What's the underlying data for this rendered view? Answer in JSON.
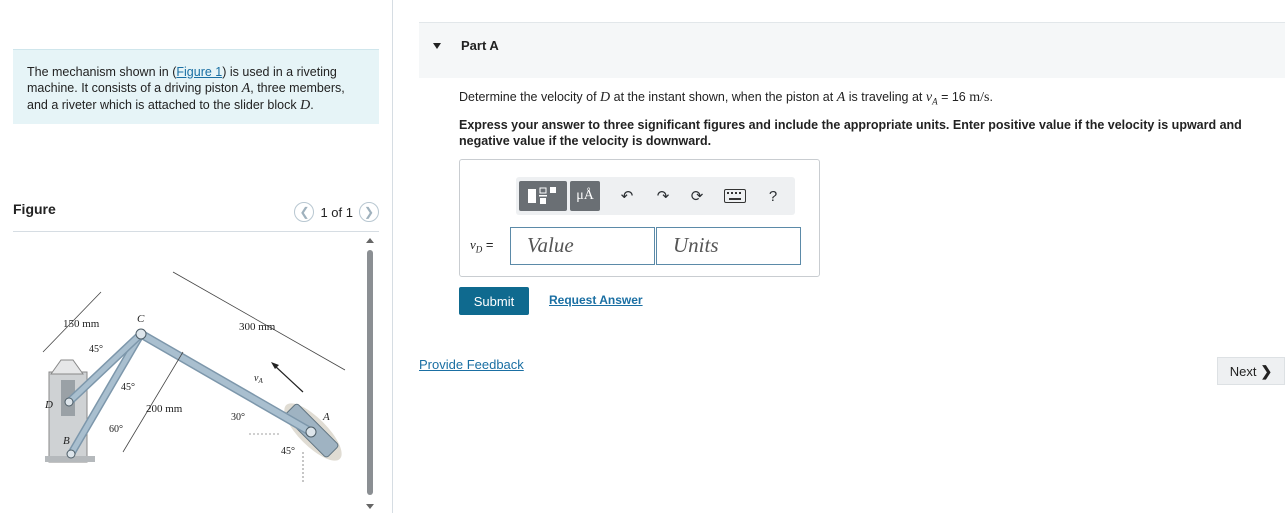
{
  "problem": {
    "text_before_link": "The mechanism shown in (",
    "link": "Figure 1",
    "text_line1_after": ") is used in a riveting",
    "text_line2": "machine. It consists of a driving piston ",
    "var_a": "A",
    "text_line2_after": ", three members,",
    "text_line3": "and a riveter which is attached to the slider block ",
    "var_d": "D",
    "text_line3_end": "."
  },
  "figure": {
    "title": "Figure",
    "page_label": "1 of 1",
    "labels": {
      "d150": "150 mm",
      "d300": "300 mm",
      "d200": "200 mm",
      "a45_top": "45°",
      "a45_mid": "45°",
      "a60": "60°",
      "a30": "30°",
      "a45_bot": "45°",
      "pt_c": "C",
      "pt_d": "D",
      "pt_b": "B",
      "pt_a": "A",
      "va": "v",
      "va_sub": "A"
    }
  },
  "part": {
    "label": "Part A",
    "question_before": "Determine the velocity of ",
    "q_var_d": "D",
    "question_mid": " at the instant shown, when the piston at ",
    "q_var_a": "A",
    "question_mid2": " is traveling at ",
    "q_va": "v",
    "q_va_sub": "A",
    "q_eq": " = 16 ",
    "q_unit": "m/s",
    "q_end": ".",
    "instructions": "Express your answer to three significant figures and include the appropriate units. Enter positive value if the velocity is upward and negative value if the velocity is downward."
  },
  "answer": {
    "var": "v",
    "var_sub": "D",
    "equals": " =",
    "value_placeholder": "Value",
    "units_placeholder": "Units",
    "toolbar": {
      "mu": "μÅ",
      "help": "?"
    }
  },
  "actions": {
    "submit": "Submit",
    "request_answer": "Request Answer",
    "provide_feedback": "Provide Feedback",
    "next": "Next"
  },
  "colors": {
    "accent": "#0f6a8f",
    "link": "#1a6fa3",
    "intro_bg": "#e6f4f7"
  }
}
